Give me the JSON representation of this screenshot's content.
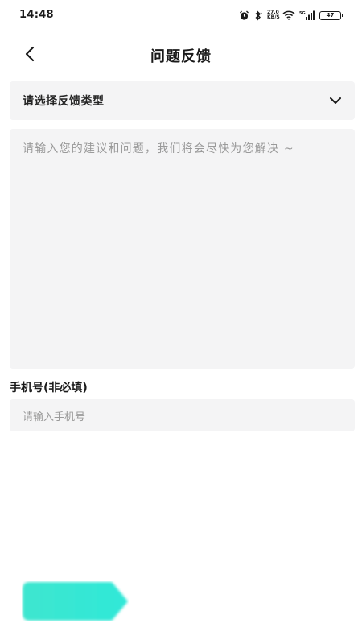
{
  "status_bar": {
    "time": "14:48",
    "network_speed_top": "27.0",
    "network_speed_bottom": "KB/S",
    "signal_label": "5G",
    "battery": "47"
  },
  "header": {
    "title": "问题反馈"
  },
  "form": {
    "type_select": {
      "placeholder": "请选择反馈类型"
    },
    "feedback": {
      "placeholder": "请输入您的建议和问题，我们将会尽快为您解决 ~"
    },
    "phone": {
      "label": "手机号(非必填)",
      "placeholder": "请输入手机号"
    }
  },
  "colors": {
    "accent_start": "#3ee6cf",
    "accent_end": "#2fe8d8",
    "field_bg": "#f4f4f5",
    "placeholder": "#9a9a9a"
  },
  "icons": [
    "alarm-icon",
    "bluetooth-icon",
    "wifi-icon",
    "signal-icon",
    "battery-icon",
    "back-arrow-icon",
    "chevron-down-icon"
  ]
}
